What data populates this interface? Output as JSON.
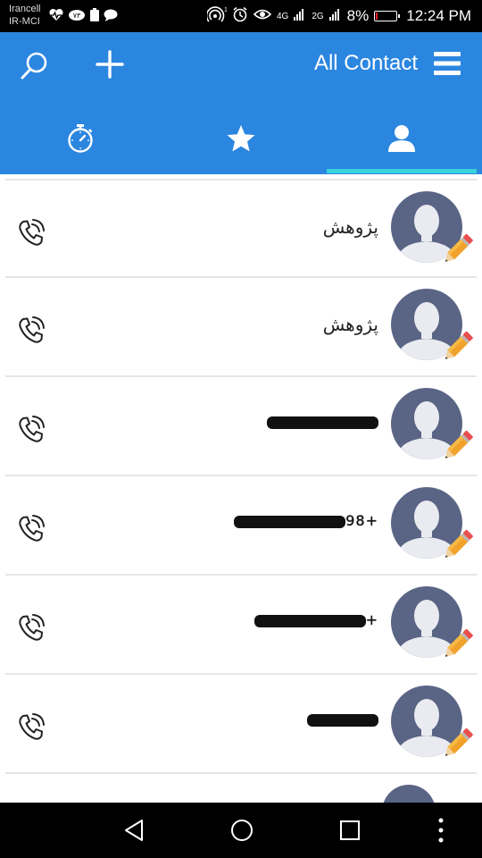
{
  "status_bar": {
    "carrier_1": "Irancell",
    "carrier_2": "IR-MCI",
    "battery_percent": "8%",
    "battery_level": 0.08,
    "time": "12:24 PM",
    "network_1": "4G",
    "network_2": "2G"
  },
  "app_bar": {
    "title": "All Contact",
    "search_icon": "search-icon",
    "add_icon": "plus-icon",
    "menu_icon": "hamburger-icon"
  },
  "tabs": [
    {
      "name": "recent",
      "icon": "stopwatch-icon",
      "active": false
    },
    {
      "name": "favorites",
      "icon": "star-icon",
      "active": false
    },
    {
      "name": "contacts",
      "icon": "person-icon",
      "active": true
    }
  ],
  "contacts": [
    {
      "name": "پژوهش",
      "redacted": false
    },
    {
      "name": "پژوهش",
      "redacted": false
    },
    {
      "name": "",
      "redacted": true
    },
    {
      "name": "+98",
      "redacted": true
    },
    {
      "name": "+",
      "redacted": true
    },
    {
      "name": "",
      "redacted": true
    }
  ],
  "colors": {
    "app_bar": "#2b86e0",
    "tab_indicator": "#39d2db",
    "avatar_bg": "#5a6485"
  }
}
